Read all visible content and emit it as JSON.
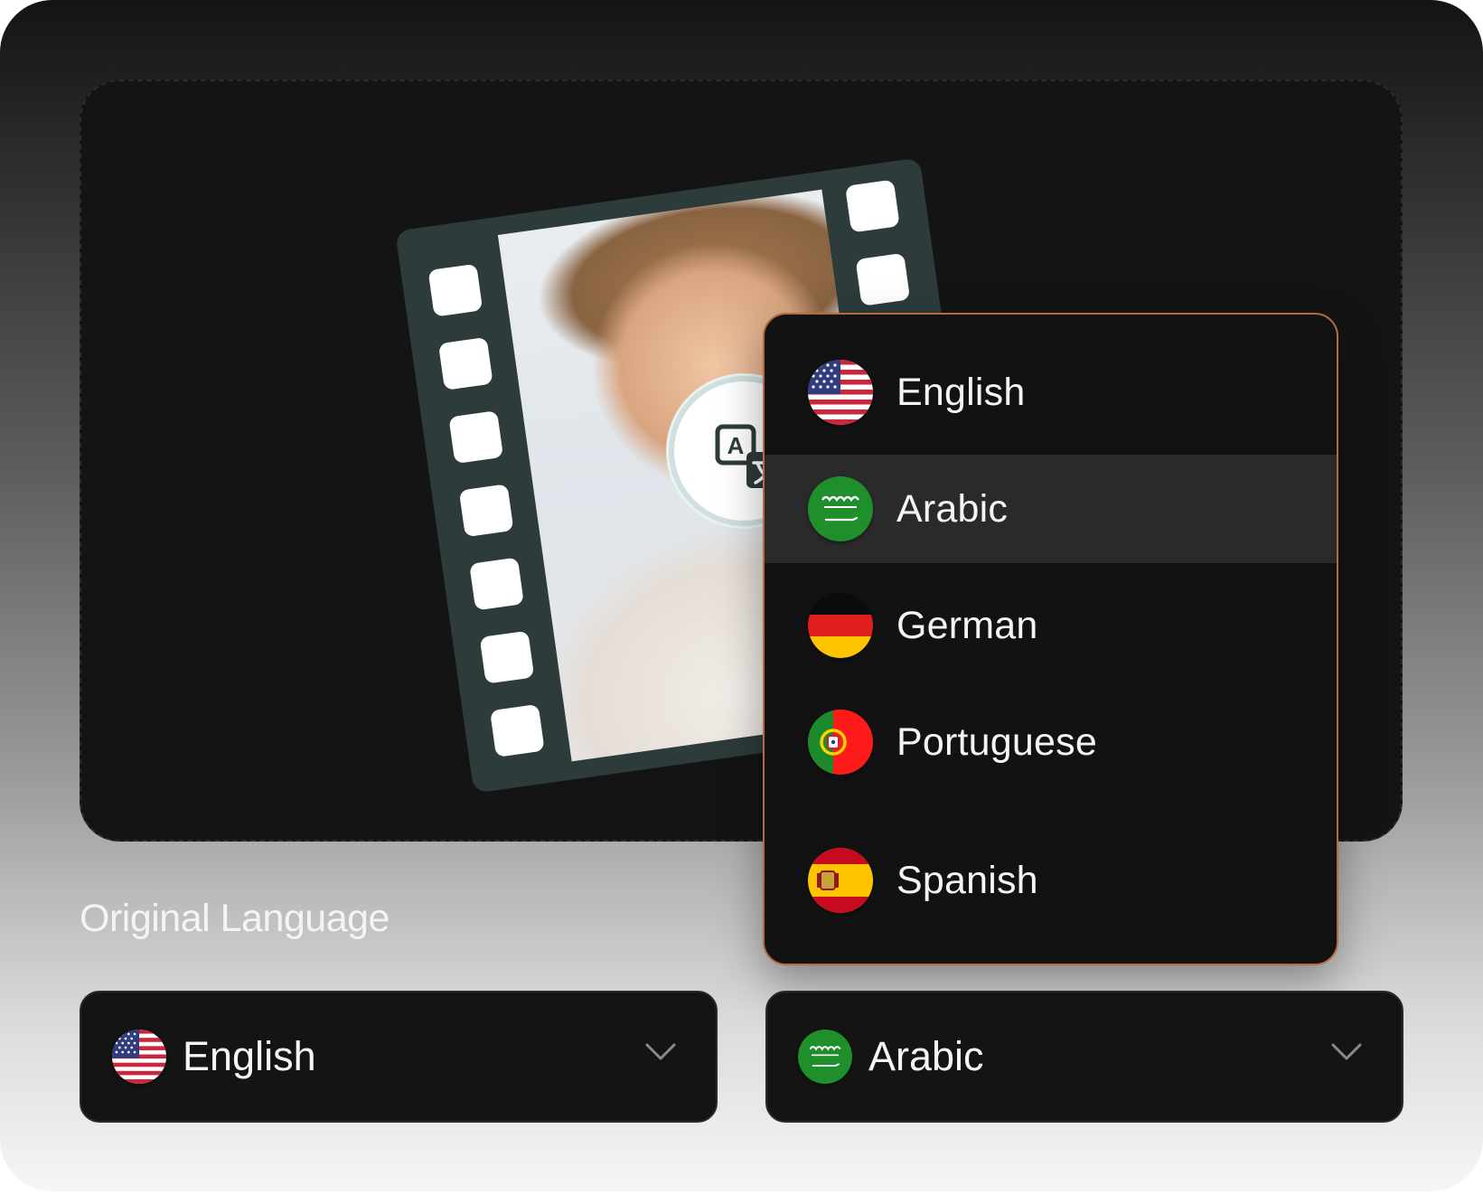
{
  "colors": {
    "panel_border": "#b76a3e",
    "panel_bg": "#121212",
    "highlight_bg": "#2b2a2b",
    "film_strip": "#2d3b3b"
  },
  "illustration": {
    "badge_icon": "translate-icon",
    "badge_letter": "A"
  },
  "dropdown": {
    "options": [
      {
        "label": "English",
        "flag": "us-flag-icon"
      },
      {
        "label": "Arabic",
        "flag": "saudi-flag-icon",
        "highlighted": true
      },
      {
        "label": "German",
        "flag": "germany-flag-icon"
      },
      {
        "label": "Portuguese",
        "flag": "portugal-flag-icon"
      },
      {
        "label": "Spanish",
        "flag": "spain-flag-icon"
      }
    ]
  },
  "original_language": {
    "label": "Original Language",
    "selected": "English",
    "flag": "us-flag-icon",
    "chevron": "chevron-down-icon"
  },
  "target_language": {
    "selected": "Arabic",
    "flag": "saudi-flag-icon",
    "chevron": "chevron-down-icon"
  }
}
